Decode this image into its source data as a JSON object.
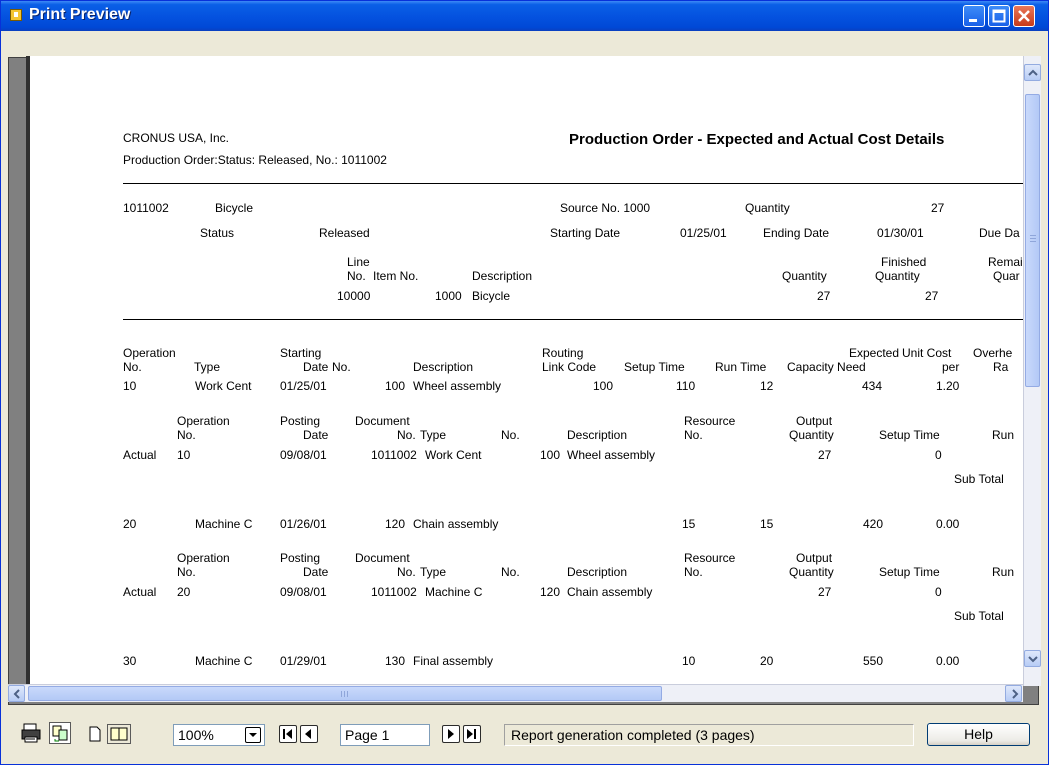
{
  "window": {
    "title": "Print Preview"
  },
  "report": {
    "company": "CRONUS USA, Inc.",
    "title": "Production Order - Expected and Actual Cost Details",
    "filter": "Production Order:Status: Released, No.: 1011002",
    "order": {
      "no": "1011002",
      "desc": "Bicycle",
      "source_label": "Source No. 1000",
      "quantity_label": "Quantity",
      "quantity": "27",
      "status_label": "Status",
      "status": "Released",
      "starting_label": "Starting Date",
      "starting": "01/25/01",
      "ending_label": "Ending Date",
      "ending": "01/30/01",
      "due_label": "Due Da"
    },
    "line_header": {
      "line": "Line",
      "no": "No.",
      "item_no": "Item No.",
      "description": "Description",
      "quantity": "Quantity",
      "finished1": "Finished",
      "finished2": "Quantity",
      "remaining1": "Remair",
      "remaining2": "Quar"
    },
    "line": {
      "line_no": "10000",
      "item_no": "1000",
      "description": "Bicycle",
      "quantity": "27",
      "finished": "27"
    },
    "op_header": {
      "operation1": "Operation",
      "operation2": "No.",
      "type": "Type",
      "starting1": "Starting",
      "starting2": "Date",
      "no": "No.",
      "description": "Description",
      "routing1": "Routing",
      "routing2": "Link Code",
      "setup": "Setup Time",
      "run": "Run Time",
      "expected1": "Expected",
      "expected2": "Capacity Need",
      "unitcost1": "Unit Cost",
      "unitcost2": "per",
      "overhead1": "Overhe",
      "overhead2": "Ra"
    },
    "actual_header": {
      "operation1": "Operation",
      "operation2": "No.",
      "posting1": "Posting",
      "posting2": "Date",
      "document1": "Document",
      "document2": "No.",
      "type": "Type",
      "no": "No.",
      "description": "Description",
      "resource1": "Resource",
      "resource2": "No.",
      "output1": "Output",
      "output2": "Quantity",
      "setup": "Setup Time",
      "run": "Run"
    },
    "operations": [
      {
        "op": "10",
        "type": "Work Cent",
        "start": "01/25/01",
        "no": "100",
        "desc": "Wheel assembly",
        "routing": "100",
        "setup": "110",
        "run": "12",
        "expected": "434",
        "unit": "1.20",
        "actual": {
          "label": "Actual",
          "op": "10",
          "posting": "09/08/01",
          "doc": "1011002",
          "type": "Work Cent",
          "no": "100",
          "desc": "Wheel assembly",
          "output": "27",
          "setup": "0"
        },
        "subtotal": "Sub Total"
      },
      {
        "op": "20",
        "type": "Machine C",
        "start": "01/26/01",
        "no": "120",
        "desc": "Chain assembly",
        "routing": "",
        "setup": "15",
        "run": "15",
        "expected": "420",
        "unit": "0.00",
        "actual": {
          "label": "Actual",
          "op": "20",
          "posting": "09/08/01",
          "doc": "1011002",
          "type": "Machine C",
          "no": "120",
          "desc": "Chain assembly",
          "output": "27",
          "setup": "0"
        },
        "subtotal": "Sub Total"
      },
      {
        "op": "30",
        "type": "Machine C",
        "start": "01/29/01",
        "no": "130",
        "desc": "Final assembly",
        "routing": "",
        "setup": "10",
        "run": "20",
        "expected": "550",
        "unit": "0.00"
      }
    ]
  },
  "toolbar": {
    "zoom": "100%",
    "page": "Page 1",
    "status": "Report generation completed (3 pages)",
    "help": "Help"
  }
}
